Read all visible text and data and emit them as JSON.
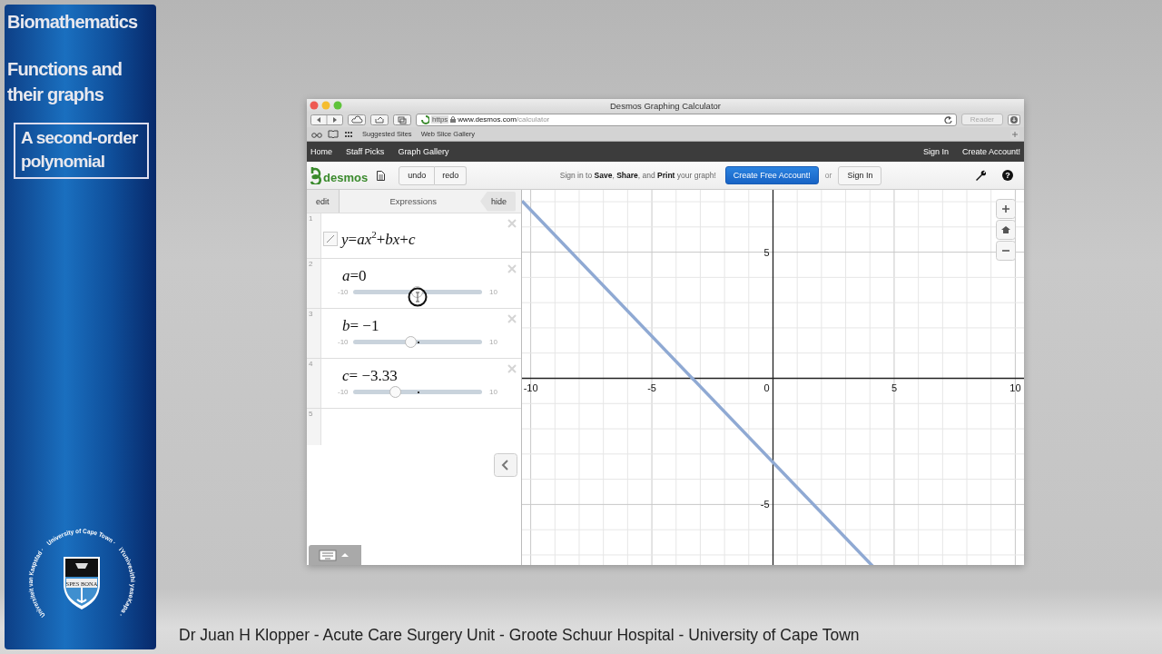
{
  "slide": {
    "title": "Biomathematics",
    "subtitle": "Functions and their graphs",
    "topic": "A second-order polynomial",
    "logo": {
      "ring_texts": [
        "University of Cape Town ·",
        "Universiteit van Kaapstad ·",
        "iYunivesithi yaseKapa ·"
      ],
      "motto": "SPES BONA"
    }
  },
  "browser": {
    "title": "Desmos Graphing Calculator",
    "url": {
      "scheme": "https",
      "host": "www.desmos.com",
      "path": "/calculator"
    },
    "reader": "Reader",
    "bookmarks": [
      "Suggested Sites",
      "Web Slice Gallery"
    ]
  },
  "site_nav": {
    "left": [
      "Home",
      "Staff Picks",
      "Graph Gallery"
    ],
    "right": [
      "Sign In",
      "Create Account!"
    ]
  },
  "toolbar": {
    "logo": "desmos",
    "undo": "undo",
    "redo": "redo",
    "prompt": "Sign in to **Save**, **Share**, and **Print** your graph!",
    "create_button": "Create Free Account!",
    "or": "or",
    "sign_in": "Sign In",
    "help": "?"
  },
  "expressions": {
    "edit": "edit",
    "title": "Expressions",
    "hide": "hide",
    "items": [
      {
        "number": "1",
        "kind": "equation",
        "latex": "*y*=*ax*$^{2}$+*bx*+*c*"
      },
      {
        "number": "2",
        "kind": "slider",
        "latex": "*a*=0",
        "min": "-10",
        "max": "10",
        "level": 0.5,
        "dragging": true
      },
      {
        "number": "3",
        "kind": "slider",
        "latex": "*b*= −1",
        "min": "-10",
        "max": "10",
        "level": 0.45,
        "dragging": false
      },
      {
        "number": "4",
        "kind": "slider",
        "latex": "*c*= −3.33",
        "min": "-10",
        "max": "10",
        "level": 0.3335,
        "dragging": false
      },
      {
        "number": "5",
        "kind": "empty"
      }
    ]
  },
  "graph": {
    "chart_data": {
      "type": "line",
      "x": [
        -10.36,
        4.14
      ],
      "xlim": [
        -10.36,
        10.36
      ],
      "ylim": [
        -7.47,
        7.47
      ],
      "xticks": [
        -10,
        -5,
        0,
        5,
        10
      ],
      "yticks": [
        -5,
        5
      ],
      "grid": true,
      "series": [
        {
          "color": "#8fa9d3",
          "values": [
            7.03,
            -7.47
          ]
        }
      ]
    }
  },
  "footer": "Dr Juan H Klopper - Acute Care Surgery Unit - Groote Schuur Hospital - University of Cape Town"
}
